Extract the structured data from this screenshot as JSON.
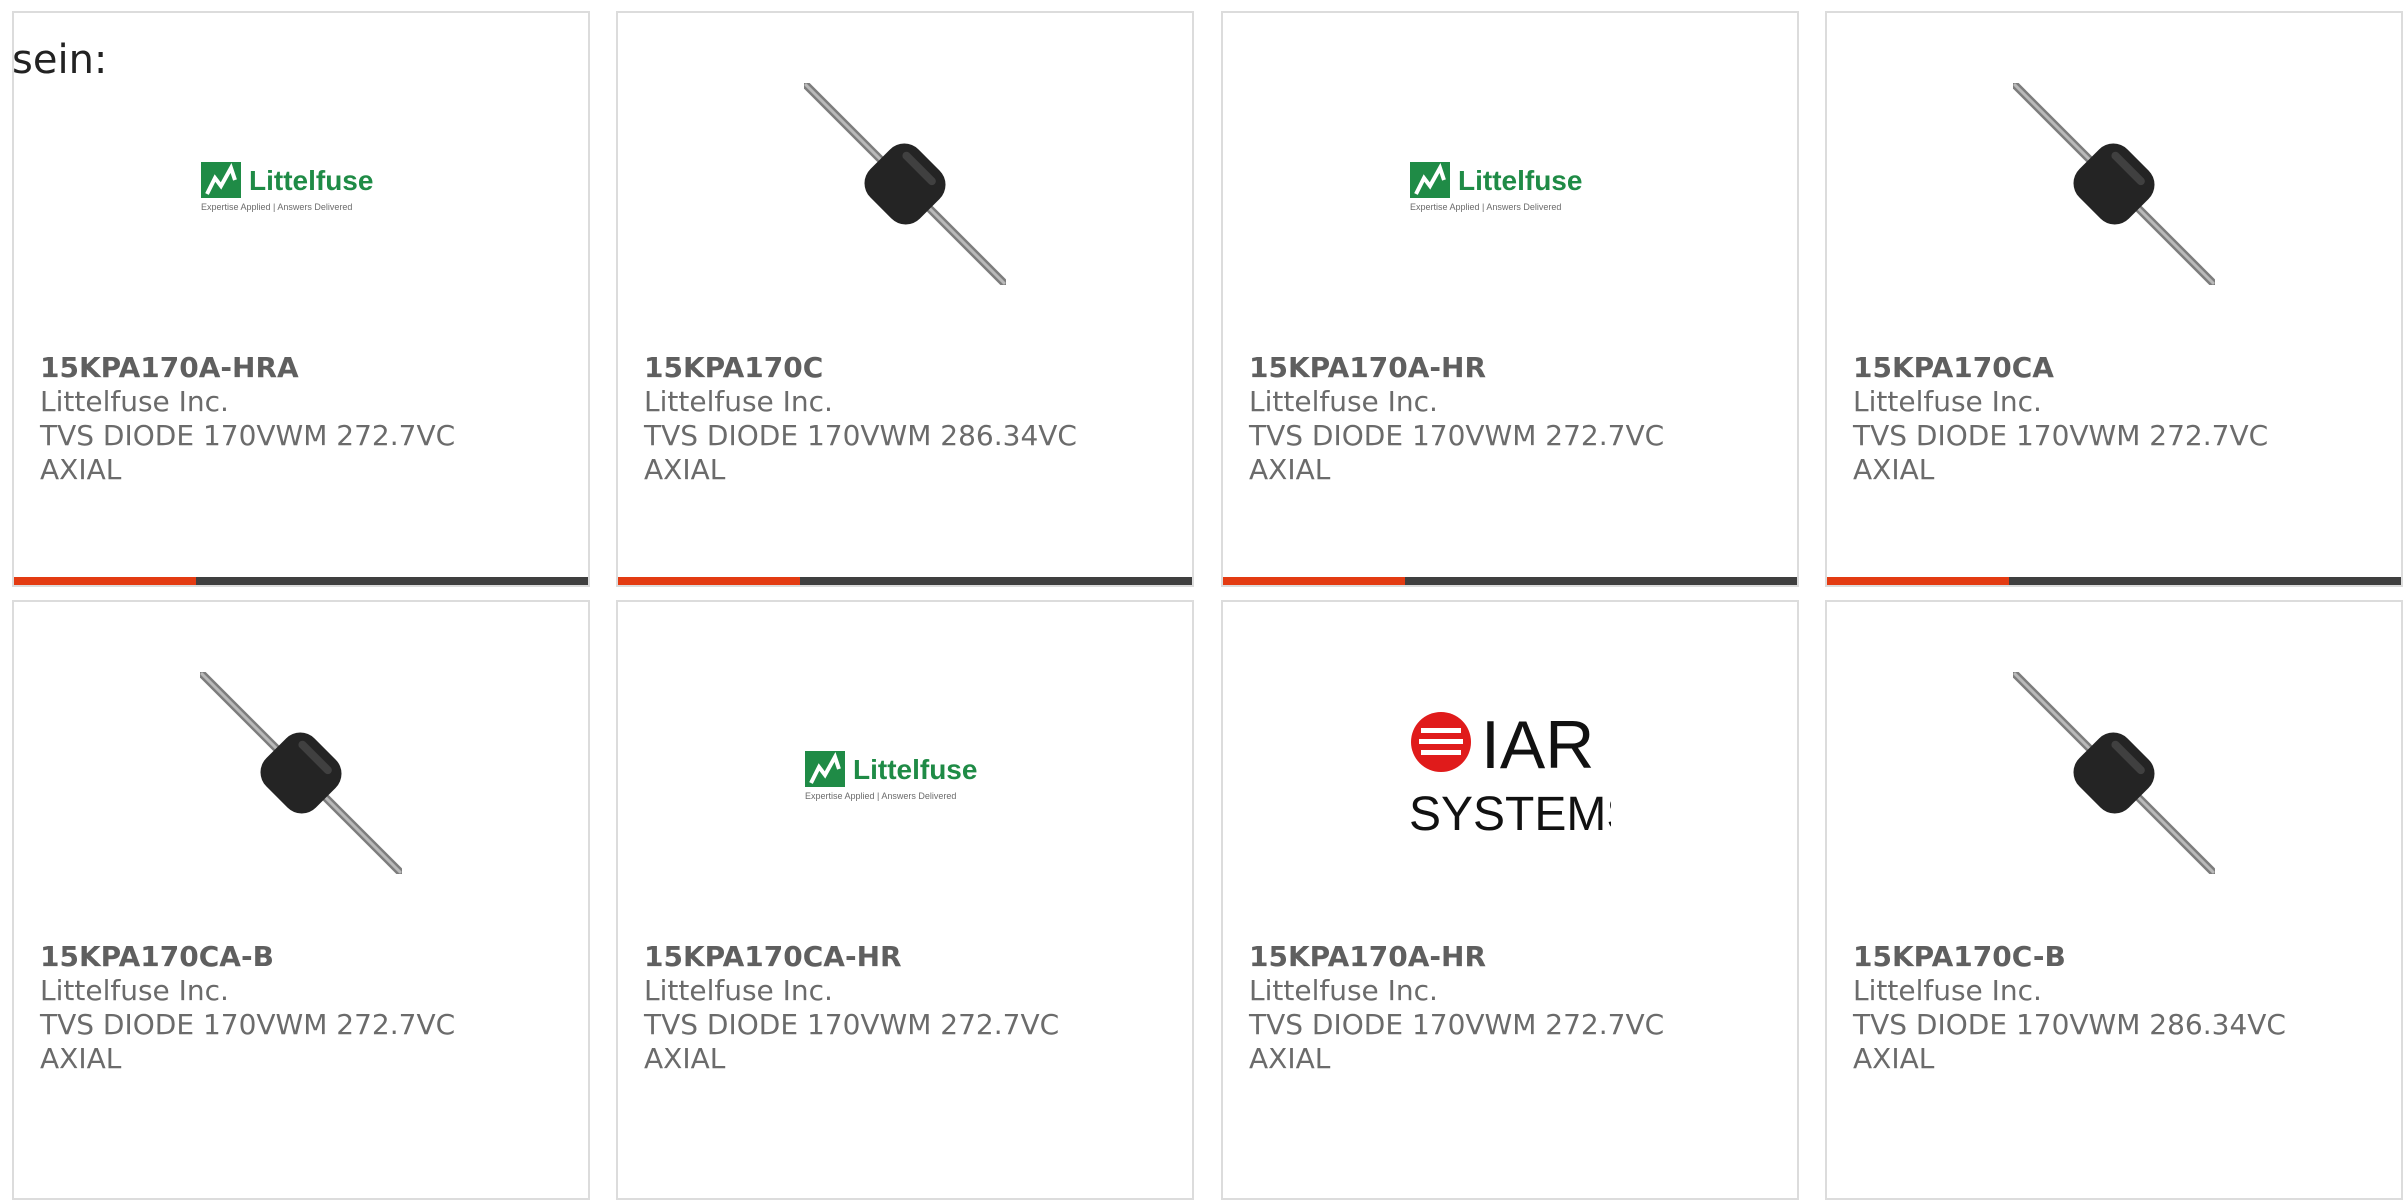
{
  "intro": "sein:",
  "colors": {
    "accent_red": "#e33b12",
    "accent_dark": "#3f3f3f",
    "littelfuse_green": "#1f8b46",
    "iar_red": "#e01b1b"
  },
  "products": [
    {
      "part": "15KPA170A-HRA",
      "manufacturer": "Littelfuse Inc.",
      "description_line1": "TVS DIODE 170VWM 272.7VC",
      "description_line2": "AXIAL",
      "image": "littelfuse-logo"
    },
    {
      "part": "15KPA170C",
      "manufacturer": "Littelfuse Inc.",
      "description_line1": "TVS DIODE 170VWM 286.34VC",
      "description_line2": "AXIAL",
      "image": "axial-diode"
    },
    {
      "part": "15KPA170A-HR",
      "manufacturer": "Littelfuse Inc.",
      "description_line1": "TVS DIODE 170VWM 272.7VC",
      "description_line2": "AXIAL",
      "image": "littelfuse-logo"
    },
    {
      "part": "15KPA170CA",
      "manufacturer": "Littelfuse Inc.",
      "description_line1": "TVS DIODE 170VWM 272.7VC",
      "description_line2": "AXIAL",
      "image": "axial-diode"
    },
    {
      "part": "15KPA170CA-B",
      "manufacturer": "Littelfuse Inc.",
      "description_line1": "TVS DIODE 170VWM 272.7VC",
      "description_line2": "AXIAL",
      "image": "axial-diode"
    },
    {
      "part": "15KPA170CA-HR",
      "manufacturer": "Littelfuse Inc.",
      "description_line1": "TVS DIODE 170VWM 272.7VC",
      "description_line2": "AXIAL",
      "image": "littelfuse-logo"
    },
    {
      "part": "15KPA170A-HR",
      "manufacturer": "Littelfuse Inc.",
      "description_line1": "TVS DIODE 170VWM 272.7VC",
      "description_line2": "AXIAL",
      "image": "iar-systems-logo"
    },
    {
      "part": "15KPA170C-B",
      "manufacturer": "Littelfuse Inc.",
      "description_line1": "TVS DIODE 170VWM 286.34VC",
      "description_line2": "AXIAL",
      "image": "axial-diode"
    }
  ],
  "logos": {
    "littelfuse_name": "Littelfuse",
    "littelfuse_tagline": "Expertise Applied | Answers Delivered",
    "iar_name": "IAR",
    "iar_subtitle": "SYSTEMS"
  }
}
